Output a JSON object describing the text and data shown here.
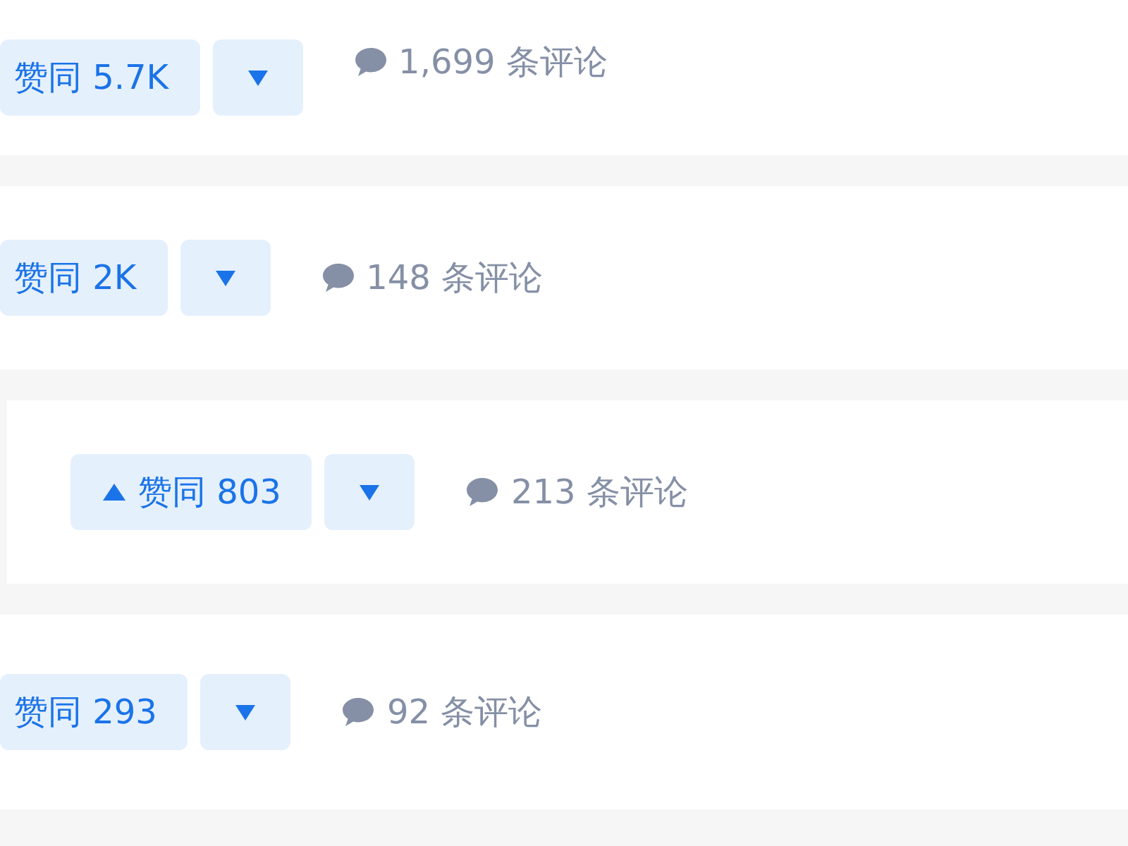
{
  "answers": [
    {
      "upvote": {
        "label": "赞同 5.7K",
        "arrow_visible": false
      },
      "comments": "1,699 条评论"
    },
    {
      "upvote": {
        "label": "赞同 2K",
        "arrow_visible": false
      },
      "comments": "148 条评论"
    },
    {
      "upvote": {
        "label": "赞同 803",
        "arrow_visible": true
      },
      "comments": "213 条评论"
    },
    {
      "upvote": {
        "label": "赞同 293",
        "arrow_visible": false
      },
      "comments": "92 条评论"
    }
  ]
}
